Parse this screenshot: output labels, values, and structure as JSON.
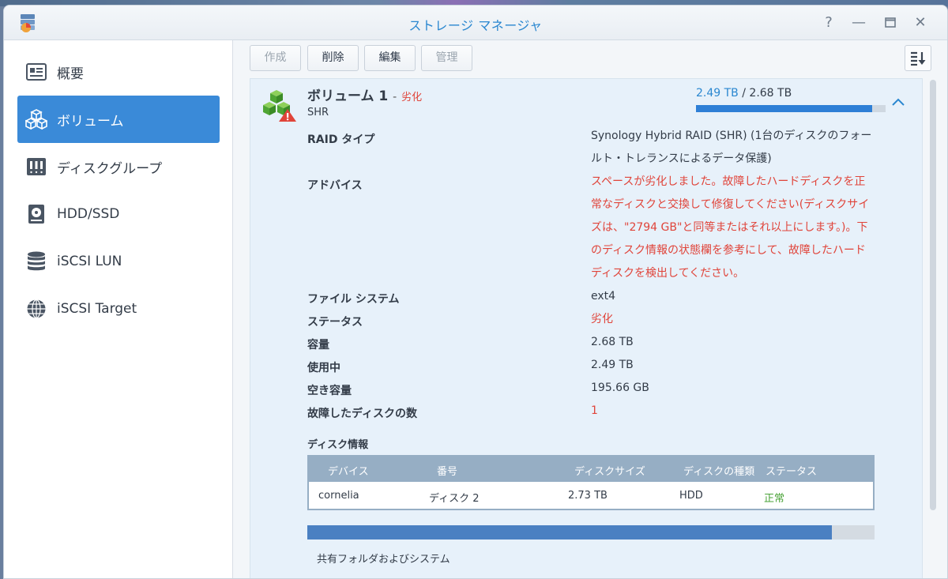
{
  "window": {
    "title": "ストレージ マネージャ"
  },
  "sidebar": {
    "items": [
      {
        "label": "概要",
        "icon": "overview-icon"
      },
      {
        "label": "ボリューム",
        "icon": "volume-icon"
      },
      {
        "label": "ディスクグループ",
        "icon": "disk-group-icon"
      },
      {
        "label": "HDD/SSD",
        "icon": "hdd-icon"
      },
      {
        "label": "iSCSI LUN",
        "icon": "database-icon"
      },
      {
        "label": "iSCSI Target",
        "icon": "globe-icon"
      }
    ],
    "active_index": 1
  },
  "toolbar": {
    "create": "作成",
    "delete": "削除",
    "edit": "編集",
    "manage": "管理"
  },
  "volume": {
    "name": "ボリューム 1",
    "separator": "-",
    "status": "劣化",
    "type": "SHR",
    "used": "2.49 TB",
    "slash": "/",
    "total": "2.68 TB",
    "usage_fraction": 0.929
  },
  "properties": {
    "raid_label": "RAID タイプ",
    "raid_value": "Synology Hybrid RAID (SHR) (1台のディスクのフォールト・トレランスによるデータ保護)",
    "advice_label": "アドバイス",
    "advice_value": "スペースが劣化しました。故障したハードディスクを正常なディスクと交換して修復してください(ディスクサイズは、\"2794 GB\"と同等またはそれ以上にします。)。下のディスク情報の状態欄を参考にして、故障したハードディスクを検出してください。",
    "fs_label": "ファイル システム",
    "fs_value": "ext4",
    "status_label": "ステータス",
    "status_value": "劣化",
    "capacity_label": "容量",
    "capacity_value": "2.68 TB",
    "used_label": "使用中",
    "used_value": "2.49 TB",
    "free_label": "空き容量",
    "free_value": "195.66 GB",
    "failed_label": "故障したディスクの数",
    "failed_value": "1"
  },
  "disk_info": {
    "title": "ディスク情報",
    "headers": [
      "デバイス",
      "番号",
      "ディスクサイズ",
      "ディスクの種類",
      "ステータス"
    ],
    "rows": [
      [
        "cornelia",
        "ディスク 2",
        "2.73 TB",
        "HDD",
        "正常"
      ]
    ]
  },
  "capacity_bar": {
    "label": "共有フォルダおよびシステム",
    "fraction": 0.925
  },
  "colors": {
    "accent": "#3a8ad8",
    "warning": "#e0443a",
    "ok": "#4aa338"
  }
}
